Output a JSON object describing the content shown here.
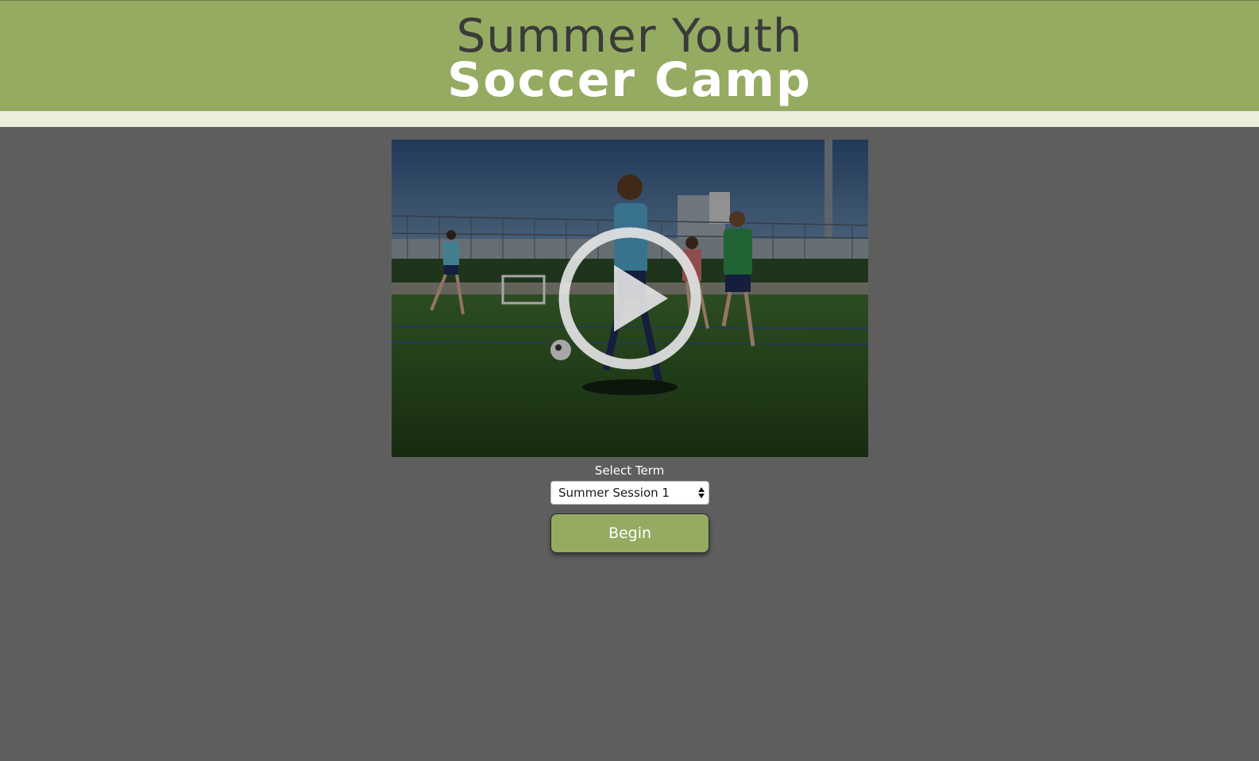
{
  "header": {
    "title_line1": "Summer Youth",
    "title_line2": "Soccer Camp"
  },
  "video": {
    "play_icon": "play-icon",
    "thumbnail": "soccer-practice-photo"
  },
  "form": {
    "term_label": "Select Term",
    "term_selected": "Summer Session 1",
    "begin_label": "Begin"
  },
  "colors": {
    "header_green": "#95ab62",
    "stripe": "#eceedb",
    "background": "#5e5e5e",
    "title_dark": "#3a3a3a",
    "title_white": "#ffffff"
  }
}
